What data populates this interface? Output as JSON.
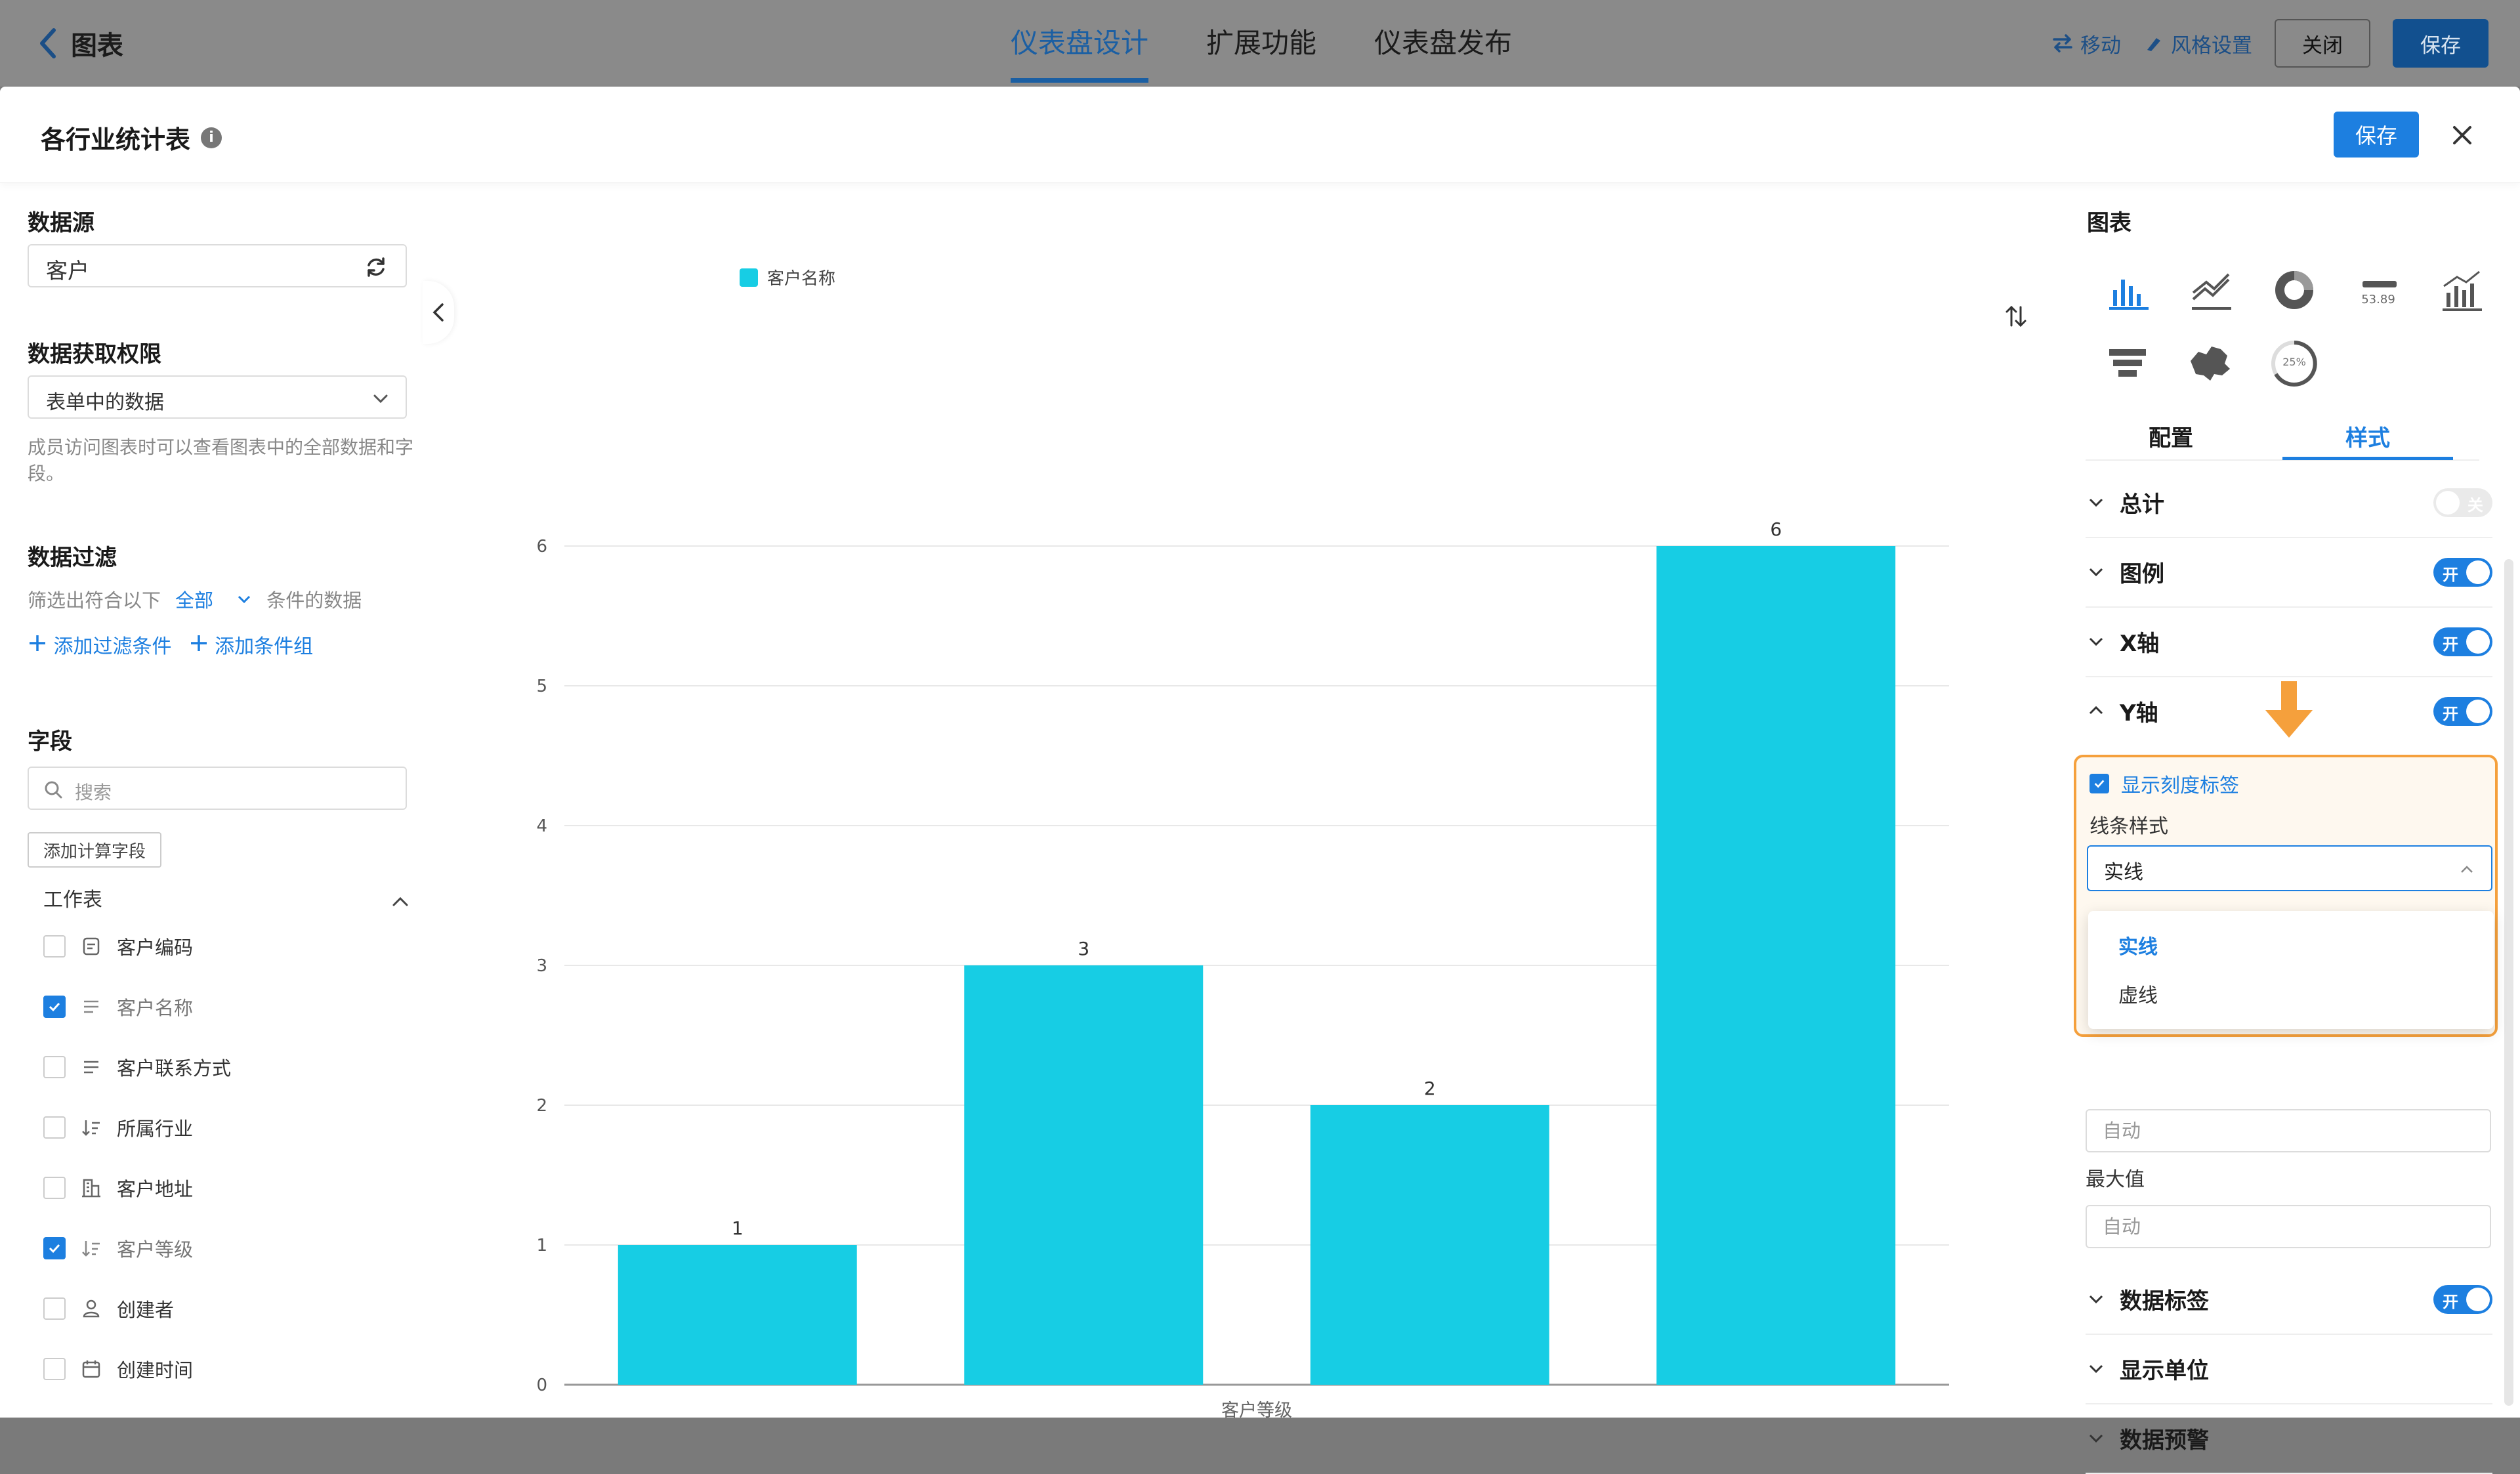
{
  "topbar": {
    "back_label": "图表",
    "tabs": [
      "仪表盘设计",
      "扩展功能",
      "仪表盘发布"
    ],
    "active_tab": 0,
    "move_label": "移动",
    "style_label": "风格设置",
    "close_label": "关闭",
    "save_label": "保存"
  },
  "dialog": {
    "title": "各行业统计表",
    "info_icon": "i",
    "save_label": "保存"
  },
  "left": {
    "datasource_title": "数据源",
    "datasource_value": "客户",
    "permission_title": "数据获取权限",
    "permission_value": "表单中的数据",
    "permission_hint": "成员访问图表时可以查看图表中的全部数据和字段。",
    "filter_title": "数据过滤",
    "filter_prefix": "筛选出符合以下",
    "filter_scope": "全部",
    "filter_suffix": "条件的数据",
    "add_condition": "添加过滤条件",
    "add_group": "添加条件组",
    "fields_title": "字段",
    "search_placeholder": "搜索",
    "add_calc_field": "添加计算字段",
    "worksheet_label": "工作表",
    "fields": [
      {
        "label": "客户编码",
        "checked": false,
        "icon": "text-field-icon"
      },
      {
        "label": "客户名称",
        "checked": true,
        "icon": "multiline-icon"
      },
      {
        "label": "客户联系方式",
        "checked": false,
        "icon": "multiline-icon"
      },
      {
        "label": "所属行业",
        "checked": false,
        "icon": "sort-list-icon"
      },
      {
        "label": "客户地址",
        "checked": false,
        "icon": "building-icon"
      },
      {
        "label": "客户等级",
        "checked": true,
        "icon": "sort-list-icon"
      },
      {
        "label": "创建者",
        "checked": false,
        "icon": "user-icon"
      },
      {
        "label": "创建时间",
        "checked": false,
        "icon": "calendar-icon"
      }
    ]
  },
  "chart_data": {
    "type": "bar",
    "categories": [
      "",
      "",
      "",
      ""
    ],
    "series": [
      {
        "name": "客户名称",
        "values": [
          1,
          3,
          2,
          6
        ],
        "color": "#17cde4"
      }
    ],
    "xlabel": "客户等级",
    "ylabel": "",
    "ylim": [
      0,
      6
    ],
    "yticks": [
      0,
      1,
      2,
      3,
      4,
      5,
      6
    ],
    "grid": true,
    "legend_position": "top-center",
    "data_labels": true
  },
  "right": {
    "title": "图表",
    "chart_types": [
      "bar-chart-icon",
      "line-chart-icon",
      "donut-chart-icon",
      "number-card-icon",
      "combo-chart-icon",
      "funnel-chart-icon",
      "map-chart-icon",
      "progress-ring-icon"
    ],
    "number_card_text": "53.89",
    "progress_text": "25%",
    "tabs": [
      "配置",
      "样式"
    ],
    "active_tab": 1,
    "sections": [
      {
        "name": "总计",
        "toggle": "关",
        "on": false
      },
      {
        "name": "图例",
        "toggle": "开",
        "on": true
      },
      {
        "name": "X轴",
        "toggle": "开",
        "on": true
      },
      {
        "name": "Y轴",
        "toggle": "开",
        "on": true,
        "expanded": true
      }
    ],
    "show_tick_labels": "显示刻度标签",
    "line_style_label": "线条样式",
    "line_style_value": "实线",
    "line_style_options": [
      "实线",
      "虚线"
    ],
    "min_placeholder": "自动",
    "max_label": "最大值",
    "max_placeholder": "自动",
    "sections_after": [
      {
        "name": "数据标签",
        "toggle": "开",
        "on": true
      },
      {
        "name": "显示单位"
      },
      {
        "name": "数据预警"
      }
    ]
  },
  "colors": {
    "accent": "#1d7fe0",
    "bar": "#17cde4",
    "highlight": "#f5a03c"
  }
}
